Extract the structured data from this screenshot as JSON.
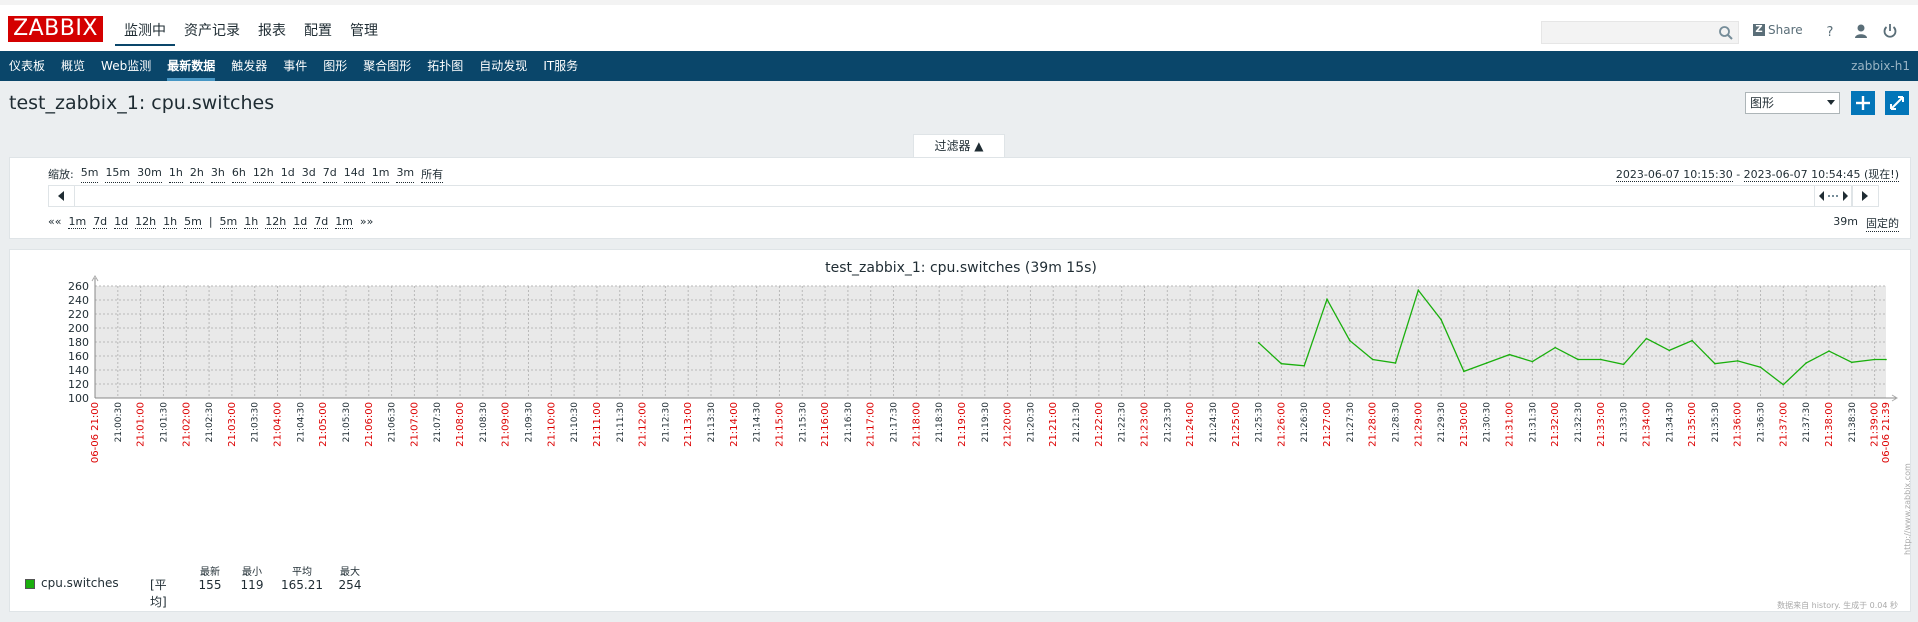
{
  "header": {
    "logo": "ZABBIX",
    "menu": [
      "监测中",
      "资产记录",
      "报表",
      "配置",
      "管理"
    ],
    "share_label": "Share",
    "help_label": "?"
  },
  "subnav": {
    "items": [
      "仪表板",
      "概览",
      "Web监测",
      "最新数据",
      "触发器",
      "事件",
      "图形",
      "聚合图形",
      "拓扑图",
      "自动发现",
      "IT服务"
    ],
    "active_index": 3,
    "server": "zabbix-h1"
  },
  "page": {
    "title": "test_zabbix_1: cpu.switches",
    "view_select": "图形",
    "add_btn": "+",
    "fullscreen_btn": "⤢"
  },
  "filter": {
    "tab_label": "过滤器 ▲",
    "zoom_label": "缩放:",
    "zoom_options": [
      "5m",
      "15m",
      "30m",
      "1h",
      "2h",
      "3h",
      "6h",
      "12h",
      "1d",
      "3d",
      "7d",
      "14d",
      "1m",
      "3m",
      "所有"
    ],
    "range_from": "2023-06-07 10:15:30",
    "range_sep": " - ",
    "range_to": "2023-06-07 10:54:45 (现在!)",
    "nav_back_all": "««",
    "nav_back": [
      "1m",
      "7d",
      "1d",
      "12h",
      "1h",
      "5m"
    ],
    "nav_sep": "|",
    "nav_fwd": [
      "5m",
      "1h",
      "12h",
      "1d",
      "7d",
      "1m"
    ],
    "nav_fwd_all": "»»",
    "period": "39m",
    "fixed": "固定的"
  },
  "graph": {
    "title": "test_zabbix_1: cpu.switches (39m 15s)",
    "legend_name": "cpu.switches",
    "legend_agg": "[平均]",
    "stats": [
      {
        "head": "最新",
        "value": "155"
      },
      {
        "head": "最小",
        "value": "119"
      },
      {
        "head": "平均",
        "value": "165.21"
      },
      {
        "head": "最大",
        "value": "254"
      }
    ],
    "footnote": "数据来自 history. 生成于 0.04 秒",
    "vertical_url": "http://www.zabbix.com"
  },
  "chart_data": {
    "type": "line",
    "series": [
      {
        "name": "cpu.switches",
        "x": [
          "21:25:30",
          "21:26:00",
          "21:26:30",
          "21:27:00",
          "21:27:30",
          "21:28:00",
          "21:28:30",
          "21:29:00",
          "21:29:30",
          "21:30:00",
          "21:30:30",
          "21:31:00",
          "21:31:30",
          "21:32:00",
          "21:32:30",
          "21:33:00",
          "21:33:30",
          "21:34:00",
          "21:34:30",
          "21:35:00",
          "21:35:30",
          "21:36:00",
          "21:36:30",
          "21:37:00",
          "21:37:30",
          "21:38:00",
          "21:38:30",
          "21:39:00",
          "21:39:15"
        ],
        "values": [
          179,
          149,
          146,
          241,
          182,
          155,
          150,
          254,
          212,
          138,
          150,
          162,
          152,
          172,
          155,
          155,
          148,
          185,
          168,
          182,
          149,
          153,
          144,
          119,
          150,
          167,
          151,
          155,
          155
        ]
      }
    ],
    "ylim": [
      100,
      260
    ],
    "yticks": [
      100,
      120,
      140,
      160,
      180,
      200,
      220,
      240,
      260
    ],
    "x_start": "21:00:00",
    "x_end": "21:39:15",
    "x_start_label": "06-06 21:00",
    "x_end_label": "06-06 21:39",
    "x_tick_step_seconds": 30,
    "line_color": "#1aaf0d",
    "grid": true
  }
}
